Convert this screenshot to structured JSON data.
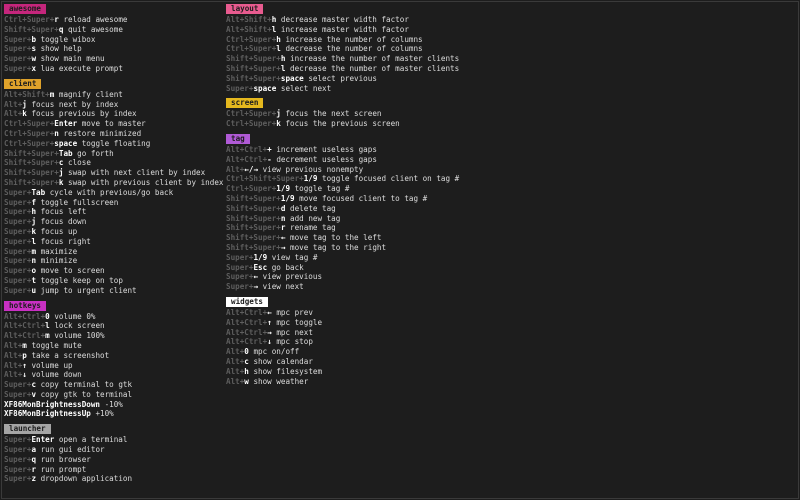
{
  "colors": {
    "background": "#1d1d1d",
    "modifier": "#5e5e5e",
    "key": "#ffffff",
    "description": "#dcdcdc"
  },
  "columns": [
    {
      "groups": [
        {
          "title": "awesome",
          "bg": "#c5267c",
          "fg": "#1d1d1d",
          "items": [
            {
              "mod": "Ctrl+Super+",
              "key": "r",
              "desc": "reload awesome"
            },
            {
              "mod": "Shift+Super+",
              "key": "q",
              "desc": "quit awesome"
            },
            {
              "mod": "Super+",
              "key": "b",
              "desc": "toggle wibox"
            },
            {
              "mod": "Super+",
              "key": "s",
              "desc": "show help"
            },
            {
              "mod": "Super+",
              "key": "w",
              "desc": "show main menu"
            },
            {
              "mod": "Super+",
              "key": "x",
              "desc": "lua execute prompt"
            }
          ]
        },
        {
          "title": "client",
          "bg": "#dfa22b",
          "fg": "#1d1d1d",
          "items": [
            {
              "mod": "Alt+Shift+",
              "key": "m",
              "desc": "magnify client"
            },
            {
              "mod": "Alt+",
              "key": "j",
              "desc": "focus next by index"
            },
            {
              "mod": "Alt+",
              "key": "k",
              "desc": "focus previous by index"
            },
            {
              "mod": "Ctrl+Super+",
              "key": "Enter",
              "desc": "move to master"
            },
            {
              "mod": "Ctrl+Super+",
              "key": "n",
              "desc": "restore minimized"
            },
            {
              "mod": "Ctrl+Super+",
              "key": "space",
              "desc": "toggle floating"
            },
            {
              "mod": "Shift+Super+",
              "key": "Tab",
              "desc": "go forth"
            },
            {
              "mod": "Shift+Super+",
              "key": "c",
              "desc": "close"
            },
            {
              "mod": "Shift+Super+",
              "key": "j",
              "desc": "swap with next client by index"
            },
            {
              "mod": "Shift+Super+",
              "key": "k",
              "desc": "swap with previous client by index"
            },
            {
              "mod": "Super+",
              "key": "Tab",
              "desc": "cycle with previous/go back"
            },
            {
              "mod": "Super+",
              "key": "f",
              "desc": "toggle fullscreen"
            },
            {
              "mod": "Super+",
              "key": "h",
              "desc": "focus left"
            },
            {
              "mod": "Super+",
              "key": "j",
              "desc": "focus down"
            },
            {
              "mod": "Super+",
              "key": "k",
              "desc": "focus up"
            },
            {
              "mod": "Super+",
              "key": "l",
              "desc": "focus right"
            },
            {
              "mod": "Super+",
              "key": "m",
              "desc": "maximize"
            },
            {
              "mod": "Super+",
              "key": "n",
              "desc": "minimize"
            },
            {
              "mod": "Super+",
              "key": "o",
              "desc": "move to screen"
            },
            {
              "mod": "Super+",
              "key": "t",
              "desc": "toggle keep on top"
            },
            {
              "mod": "Super+",
              "key": "u",
              "desc": "jump to urgent client"
            }
          ]
        },
        {
          "title": "hotkeys",
          "bg": "#c930c3",
          "fg": "#1d1d1d",
          "items": [
            {
              "mod": "Alt+Ctrl+",
              "key": "0",
              "desc": "volume 0%"
            },
            {
              "mod": "Alt+Ctrl+",
              "key": "l",
              "desc": "lock screen"
            },
            {
              "mod": "Alt+Ctrl+",
              "key": "m",
              "desc": "volume 100%"
            },
            {
              "mod": "Alt+",
              "key": "m",
              "desc": "toggle mute"
            },
            {
              "mod": "Alt+",
              "key": "p",
              "desc": "take a screenshot"
            },
            {
              "mod": "Alt+",
              "key": "↑",
              "desc": "volume up"
            },
            {
              "mod": "Alt+",
              "key": "↓",
              "desc": "volume down"
            },
            {
              "mod": "Super+",
              "key": "c",
              "desc": "copy terminal to gtk"
            },
            {
              "mod": "Super+",
              "key": "v",
              "desc": "copy gtk to terminal"
            },
            {
              "mod": "",
              "key": "XF86MonBrightnessDown",
              "desc": "-10%"
            },
            {
              "mod": "",
              "key": "XF86MonBrightnessUp",
              "desc": "+10%"
            }
          ]
        },
        {
          "title": "launcher",
          "bg": "#a5a5a5",
          "fg": "#1d1d1d",
          "items": [
            {
              "mod": "Super+",
              "key": "Enter",
              "desc": "open a terminal"
            },
            {
              "mod": "Super+",
              "key": "a",
              "desc": "run gui editor"
            },
            {
              "mod": "Super+",
              "key": "q",
              "desc": "run browser"
            },
            {
              "mod": "Super+",
              "key": "r",
              "desc": "run prompt"
            },
            {
              "mod": "Super+",
              "key": "z",
              "desc": "dropdown application"
            }
          ]
        }
      ]
    },
    {
      "groups": [
        {
          "title": "layout",
          "bg": "#e85b8f",
          "fg": "#1d1d1d",
          "items": [
            {
              "mod": "Alt+Shift+",
              "key": "h",
              "desc": "decrease master width factor"
            },
            {
              "mod": "Alt+Shift+",
              "key": "l",
              "desc": "increase master width factor"
            },
            {
              "mod": "Ctrl+Super+",
              "key": "h",
              "desc": "increase the number of columns"
            },
            {
              "mod": "Ctrl+Super+",
              "key": "l",
              "desc": "decrease the number of columns"
            },
            {
              "mod": "Shift+Super+",
              "key": "h",
              "desc": "increase the number of master clients"
            },
            {
              "mod": "Shift+Super+",
              "key": "l",
              "desc": "decrease the number of master clients"
            },
            {
              "mod": "Shift+Super+",
              "key": "space",
              "desc": "select previous"
            },
            {
              "mod": "Super+",
              "key": "space",
              "desc": "select next"
            }
          ]
        },
        {
          "title": "screen",
          "bg": "#e5b81e",
          "fg": "#1d1d1d",
          "items": [
            {
              "mod": "Ctrl+Super+",
              "key": "j",
              "desc": "focus the next screen"
            },
            {
              "mod": "Ctrl+Super+",
              "key": "k",
              "desc": "focus the previous screen"
            }
          ]
        },
        {
          "title": "tag",
          "bg": "#b05ad6",
          "fg": "#1d1d1d",
          "items": [
            {
              "mod": "Alt+Ctrl+",
              "key": "+",
              "desc": "increment useless gaps"
            },
            {
              "mod": "Alt+Ctrl+",
              "key": "-",
              "desc": "decrement useless gaps"
            },
            {
              "mod": "Alt+",
              "key": "←/→",
              "desc": "view  previous nonempty"
            },
            {
              "mod": "Ctrl+Shift+Super+",
              "key": "1/9",
              "desc": "toggle focused client on tag #"
            },
            {
              "mod": "Ctrl+Super+",
              "key": "1/9",
              "desc": "toggle tag #"
            },
            {
              "mod": "Shift+Super+",
              "key": "1/9",
              "desc": "move focused client to tag #"
            },
            {
              "mod": "Shift+Super+",
              "key": "d",
              "desc": "delete tag"
            },
            {
              "mod": "Shift+Super+",
              "key": "n",
              "desc": "add new tag"
            },
            {
              "mod": "Shift+Super+",
              "key": "r",
              "desc": "rename tag"
            },
            {
              "mod": "Shift+Super+",
              "key": "←",
              "desc": "move tag to the left"
            },
            {
              "mod": "Shift+Super+",
              "key": "→",
              "desc": "move tag to the right"
            },
            {
              "mod": "Super+",
              "key": "1/9",
              "desc": "view tag #"
            },
            {
              "mod": "Super+",
              "key": "Esc",
              "desc": "go back"
            },
            {
              "mod": "Super+",
              "key": "←",
              "desc": "view previous"
            },
            {
              "mod": "Super+",
              "key": "→",
              "desc": "view next"
            }
          ]
        },
        {
          "title": "widgets",
          "bg": "#ffffff",
          "fg": "#1d1d1d",
          "items": [
            {
              "mod": "Alt+Ctrl+",
              "key": "←",
              "desc": "mpc prev"
            },
            {
              "mod": "Alt+Ctrl+",
              "key": "↑",
              "desc": "mpc toggle"
            },
            {
              "mod": "Alt+Ctrl+",
              "key": "→",
              "desc": "mpc next"
            },
            {
              "mod": "Alt+Ctrl+",
              "key": "↓",
              "desc": "mpc stop"
            },
            {
              "mod": "Alt+",
              "key": "0",
              "desc": "mpc on/off"
            },
            {
              "mod": "Alt+",
              "key": "c",
              "desc": "show calendar"
            },
            {
              "mod": "Alt+",
              "key": "h",
              "desc": "show filesystem"
            },
            {
              "mod": "Alt+",
              "key": "w",
              "desc": "show weather"
            }
          ]
        }
      ]
    }
  ]
}
